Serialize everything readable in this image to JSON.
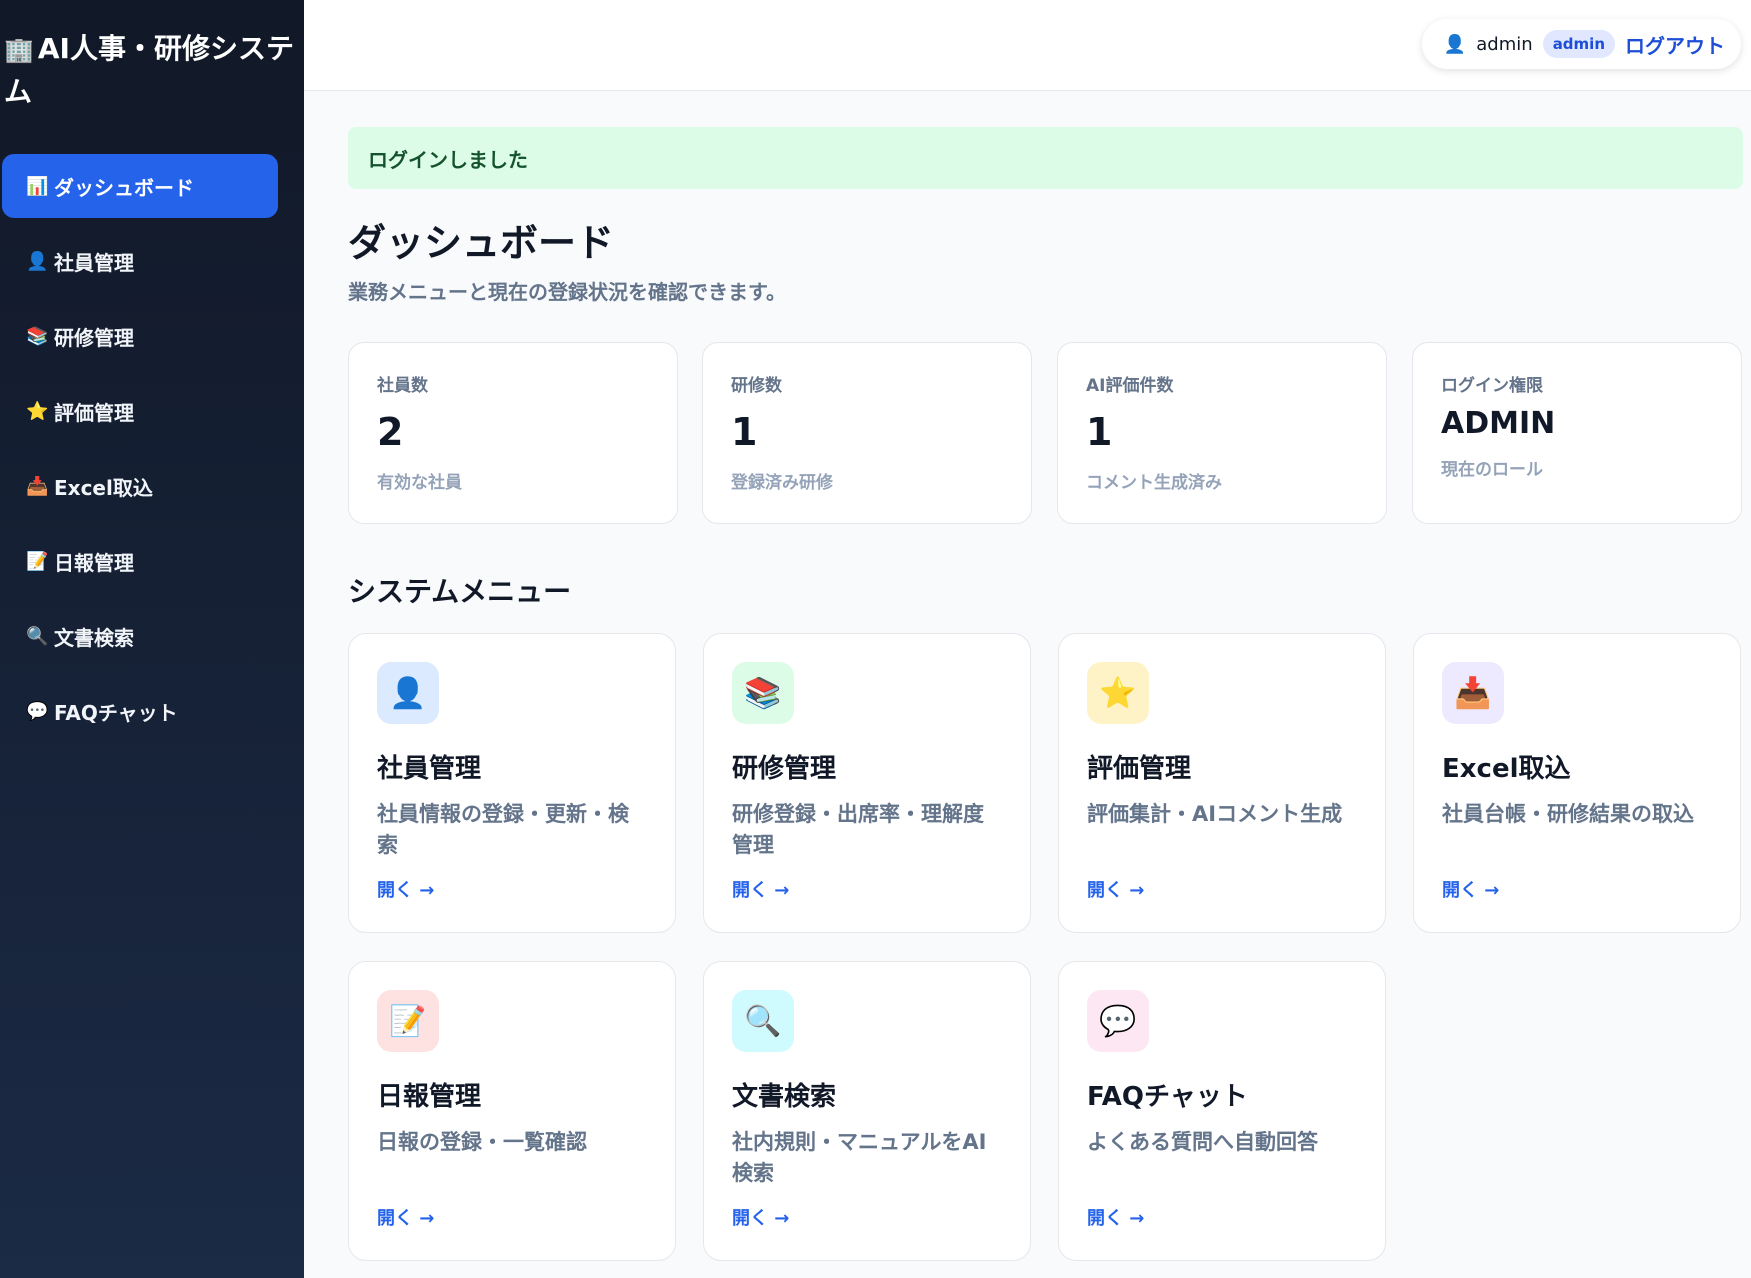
{
  "brand": {
    "icon": "🏢",
    "title": "AI人事・研修システム"
  },
  "sidebar": {
    "items": [
      {
        "icon": "📊",
        "label": "ダッシュボード",
        "active": true
      },
      {
        "icon": "👤",
        "label": "社員管理"
      },
      {
        "icon": "📚",
        "label": "研修管理"
      },
      {
        "icon": "⭐",
        "label": "評価管理"
      },
      {
        "icon": "📥",
        "label": "Excel取込"
      },
      {
        "icon": "📝",
        "label": "日報管理"
      },
      {
        "icon": "🔍",
        "label": "文書検索"
      },
      {
        "icon": "💬",
        "label": "FAQチャット"
      }
    ]
  },
  "header": {
    "user_icon": "👤",
    "username": "admin",
    "role_badge": "admin",
    "logout_label": "ログアウト"
  },
  "alert": {
    "message": "ログインしました"
  },
  "page": {
    "title": "ダッシュボード",
    "subtitle": "業務メニューと現在の登録状況を確認できます。"
  },
  "stats": [
    {
      "label": "社員数",
      "value": "2",
      "sub": "有効な社員"
    },
    {
      "label": "研修数",
      "value": "1",
      "sub": "登録済み研修"
    },
    {
      "label": "AI評価件数",
      "value": "1",
      "sub": "コメント生成済み"
    },
    {
      "label": "ログイン権限",
      "value": "ADMIN",
      "sub": "現在のロール"
    }
  ],
  "menu": {
    "title": "システムメニュー",
    "open_label": "開く →",
    "cards": [
      {
        "icon": "👤",
        "title": "社員管理",
        "desc": "社員情報の登録・更新・検索",
        "color": "#dbeafe"
      },
      {
        "icon": "📚",
        "title": "研修管理",
        "desc": "研修登録・出席率・理解度管理",
        "color": "#dcfce7"
      },
      {
        "icon": "⭐",
        "title": "評価管理",
        "desc": "評価集計・AIコメント生成",
        "color": "#fef3c7"
      },
      {
        "icon": "📥",
        "title": "Excel取込",
        "desc": "社員台帳・研修結果の取込",
        "color": "#ede9fe"
      },
      {
        "icon": "📝",
        "title": "日報管理",
        "desc": "日報の登録・一覧確認",
        "color": "#fee2e2"
      },
      {
        "icon": "🔍",
        "title": "文書検索",
        "desc": "社内規則・マニュアルをAI検索",
        "color": "#cffafe"
      },
      {
        "icon": "💬",
        "title": "FAQチャット",
        "desc": "よくある質問へ自動回答",
        "color": "#fce7f3"
      }
    ]
  },
  "colors": {
    "accent": "#2563eb",
    "sidebar": "#111827",
    "success_bg": "#dcfce7"
  }
}
